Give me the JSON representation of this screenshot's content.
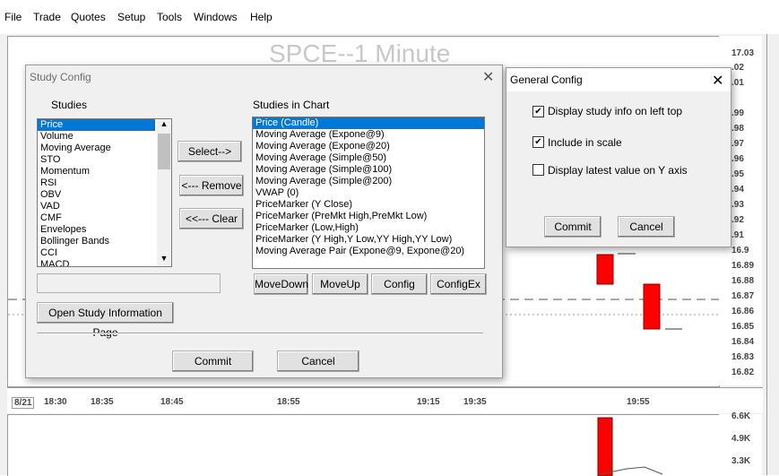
{
  "menu": [
    "File",
    "Trade",
    "Quotes",
    "Setup",
    "Tools",
    "Windows",
    "Help"
  ],
  "chart": {
    "title": "SPCE--1 Minute",
    "y_ticks": [
      "17.03",
      "17.02",
      "17.01",
      "16.99",
      "16.98",
      "16.97",
      "16.96",
      "16.95",
      "16.94",
      "16.93",
      "16.92",
      "16.91",
      "16.9",
      "16.89",
      "16.88",
      "16.87",
      "16.86",
      "16.85",
      "16.84",
      "16.83",
      "16.82"
    ],
    "y_ticks_display": [
      "17.03",
      ".02",
      ".01",
      ".99",
      ".98",
      ".97",
      ".96",
      ".95",
      ".94",
      ".93",
      ".92",
      ".91",
      "16.9",
      "16.89",
      "16.88",
      "16.87",
      "16.86",
      "16.85",
      "16.84",
      "16.83",
      "16.82"
    ],
    "x_ticks": [
      "8/21",
      "18:30",
      "18:35",
      "18:45",
      "18:55",
      "19:15",
      "19:35",
      "19:55"
    ],
    "vol_ticks": [
      "6.6K",
      "4.9K",
      "3.3K"
    ]
  },
  "study_config": {
    "title": "Study Config",
    "studies_label": "Studies",
    "studies_in_chart_label": "Studies in Chart",
    "studies": [
      "Price",
      "Volume",
      "Moving Average",
      "STO",
      "Momentum",
      "RSI",
      "OBV",
      "VAD",
      "CMF",
      "Envelopes",
      "Bollinger Bands",
      "CCI",
      "MACD"
    ],
    "selected_study": "Price",
    "chart_studies": [
      "Price (Candle)",
      "Moving Average (Expone@9)",
      "Moving Average (Expone@20)",
      "Moving Average (Simple@50)",
      "Moving Average (Simple@100)",
      "Moving Average (Simple@200)",
      "VWAP (0)",
      "PriceMarker (Y Close)",
      "PriceMarker (PreMkt High,PreMkt Low)",
      "PriceMarker (Low,High)",
      "PriceMarker (Y High,Y Low,YY High,YY Low)",
      "Moving Average Pair (Expone@9, Expone@20)"
    ],
    "select_btn": "Select-->",
    "remove_btn": "<--- Remove",
    "clear_btn": "<<--- Clear",
    "movedown_btn": "MoveDown",
    "moveup_btn": "MoveUp",
    "config_btn": "Config",
    "configex_btn": "ConfigEx",
    "open_info_btn": "Open Study Information Page",
    "commit_btn": "Commit",
    "cancel_btn": "Cancel"
  },
  "general_config": {
    "title": "General Config",
    "options": [
      {
        "label": "Display study info on left top",
        "checked": true
      },
      {
        "label": "Include in scale",
        "checked": true
      },
      {
        "label": "Display latest value on Y axis",
        "checked": false
      }
    ],
    "commit_btn": "Commit",
    "cancel_btn": "Cancel"
  },
  "colors": {
    "selection": "#0078d7",
    "candle_down": "#ff0000",
    "dialog_bg": "#f0f0f0"
  }
}
